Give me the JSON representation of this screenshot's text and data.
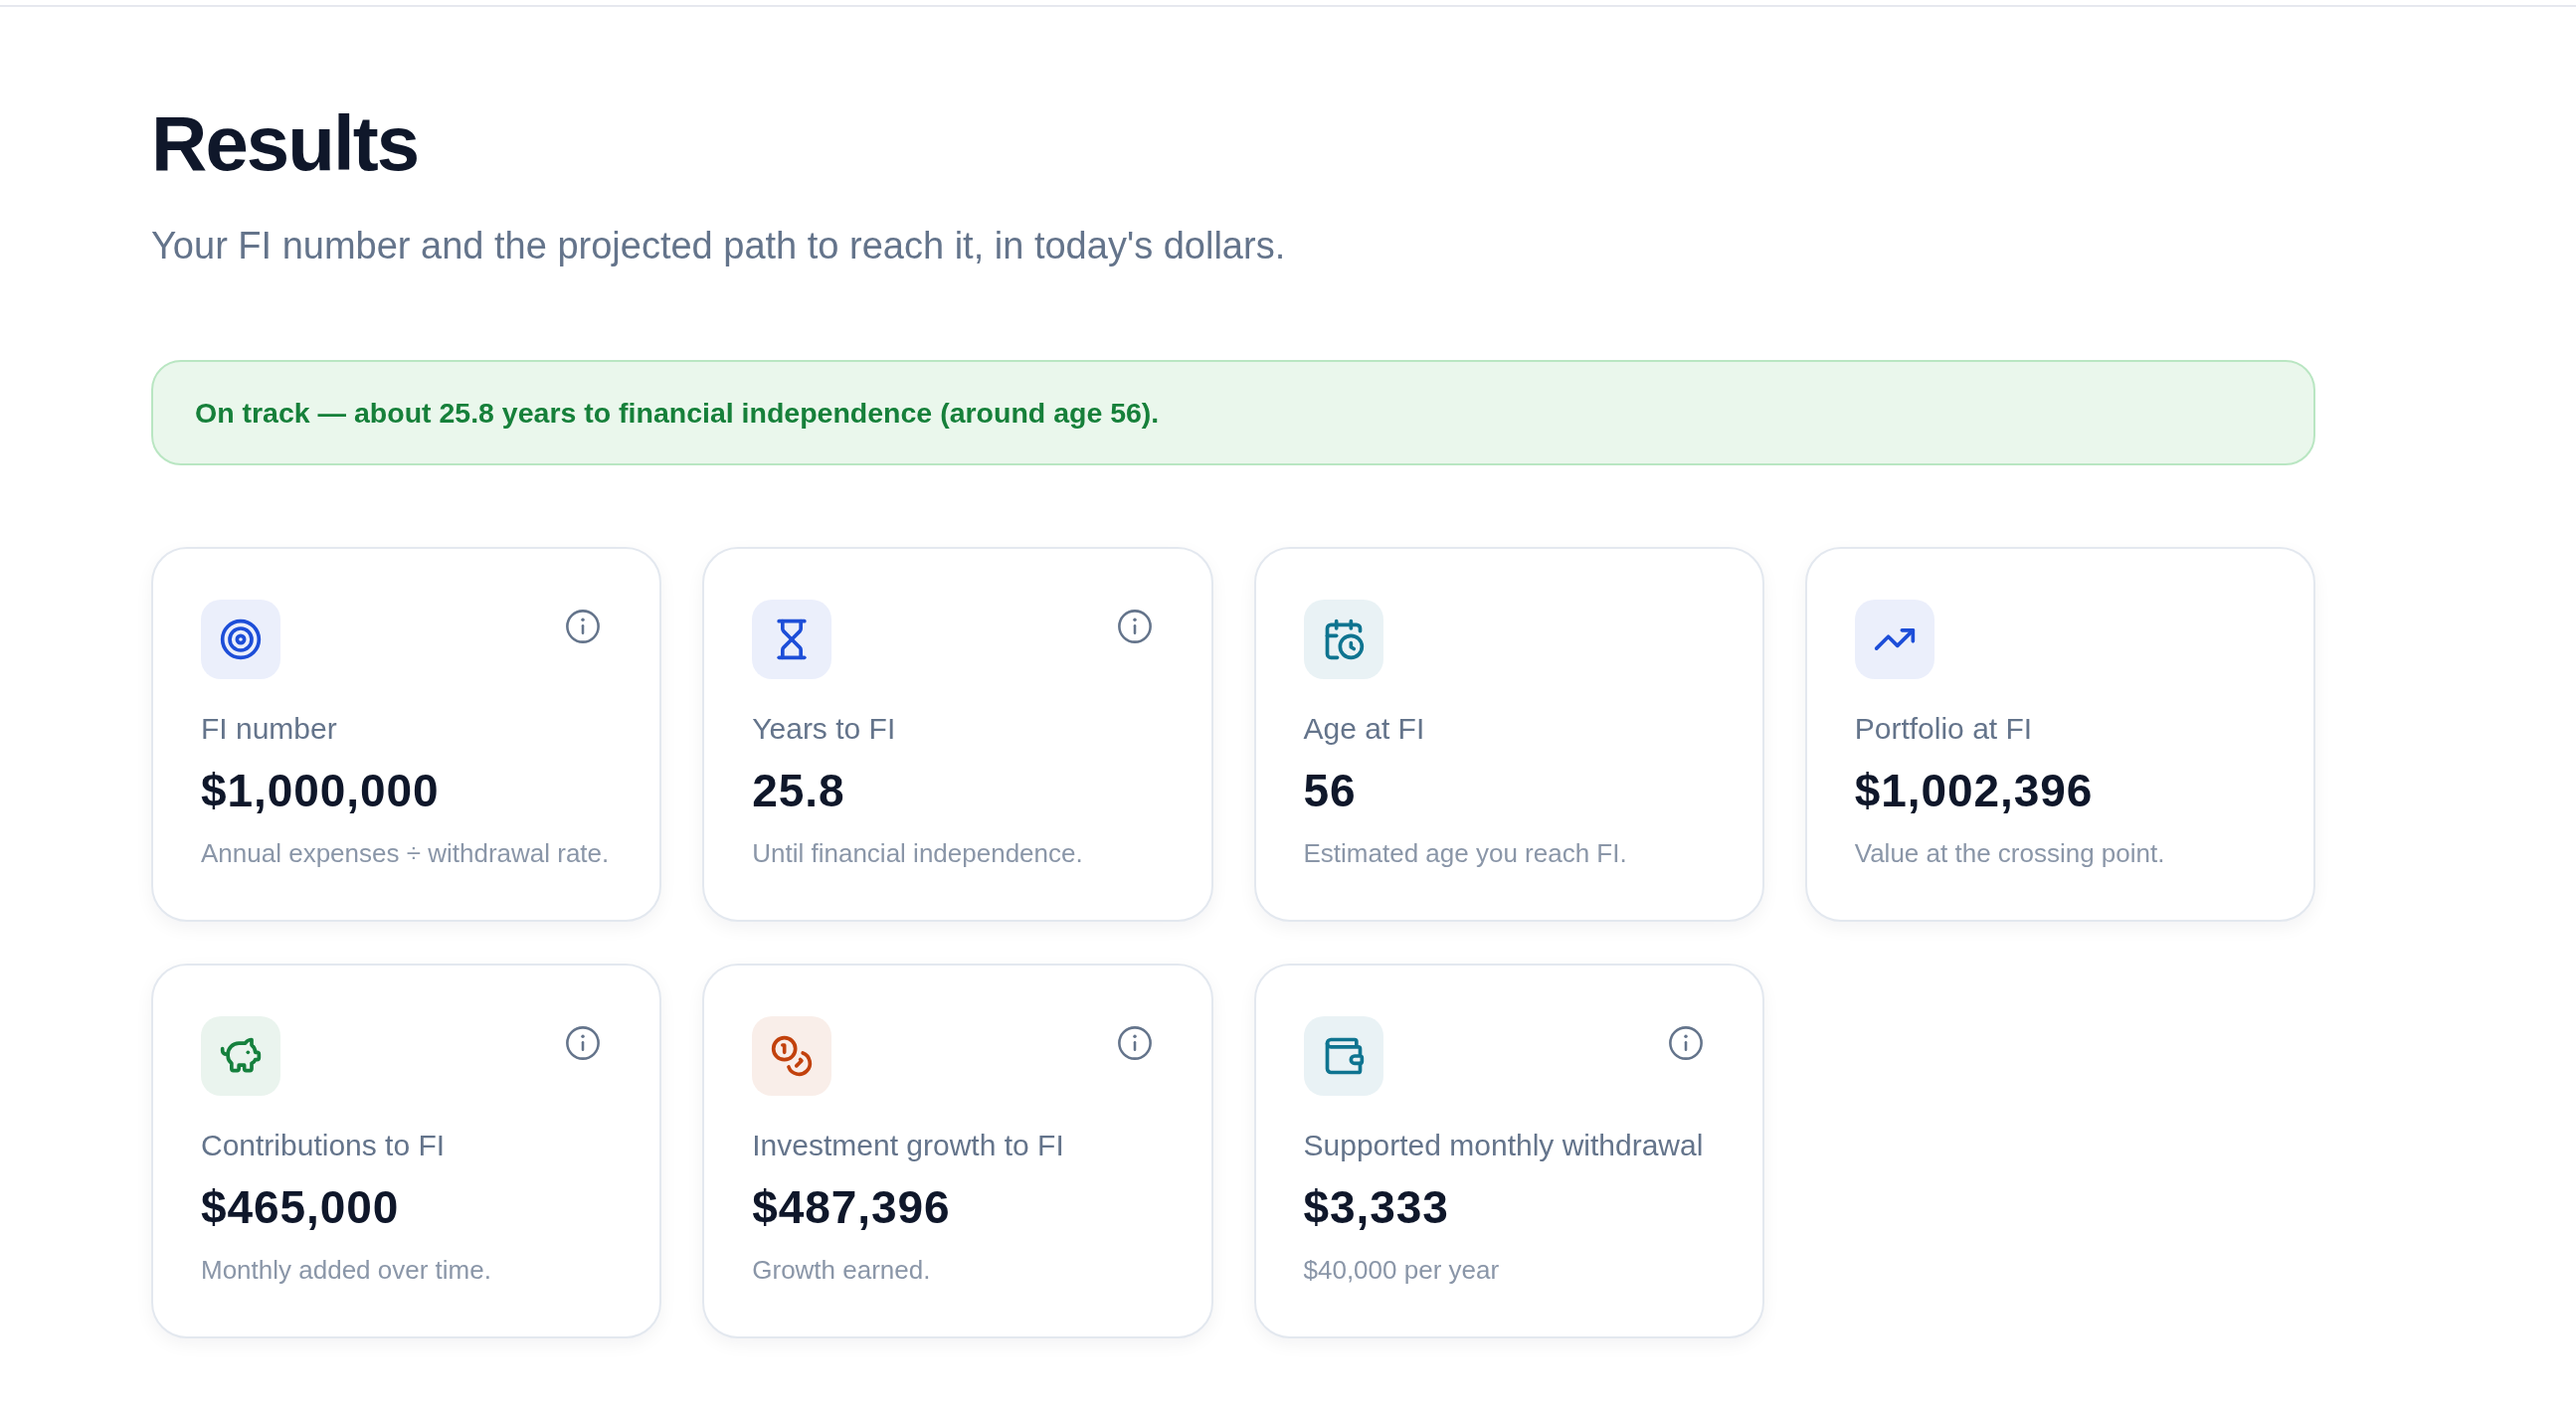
{
  "header": {
    "title": "Results",
    "subtitle": "Your FI number and the projected path to reach it, in today's dollars."
  },
  "status_banner": {
    "text": "On track — about 25.8 years to financial independence (around age 56).",
    "on_track": true
  },
  "cards": [
    {
      "label": "FI number",
      "value": "$1,000,000",
      "description": "Annual expenses ÷ withdrawal rate.",
      "color": "#1d4ed8",
      "info_button": true
    },
    {
      "label": "Years to FI",
      "value": "25.8",
      "description": "Until financial independence.",
      "color": "#1d4ed8",
      "info_button": true
    },
    {
      "label": "Age at FI",
      "value": "56",
      "description": "Estimated age you reach FI.",
      "color": "#0e7490",
      "info_button": false
    },
    {
      "label": "Portfolio at FI",
      "value": "$1,002,396",
      "description": "Value at the crossing point.",
      "color": "#1d4ed8",
      "info_button": false
    },
    {
      "label": "Contributions to FI",
      "value": "$465,000",
      "description": "Monthly added over time.",
      "color": "#15803d",
      "info_button": true
    },
    {
      "label": "Investment growth to FI",
      "value": "$487,396",
      "description": "Growth earned.",
      "color": "#c2410c",
      "info_button": true
    },
    {
      "label": "Supported monthly withdrawal",
      "value": "$3,333",
      "description": "$40,000 per year",
      "color": "#0e7490",
      "info_button": true
    }
  ]
}
